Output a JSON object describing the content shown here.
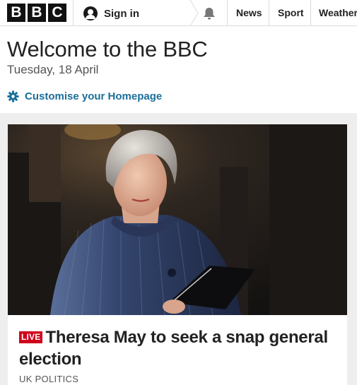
{
  "header": {
    "logo_letters": [
      "B",
      "B",
      "C"
    ],
    "signin_label": "Sign in",
    "nav": [
      {
        "label": "News"
      },
      {
        "label": "Sport"
      },
      {
        "label": "Weather"
      }
    ]
  },
  "welcome": {
    "title": "Welcome to the BBC",
    "date": "Tuesday, 18 April",
    "customise_label": "Customise your Homepage"
  },
  "story": {
    "live_badge": "LIVE",
    "headline": "Theresa May to seek a snap general election",
    "category": "UK POLITICS",
    "image_icon": "news-photo"
  },
  "colors": {
    "link_blue": "#1b6e9b",
    "live_red": "#d0021b",
    "band_grey": "#eeeeee"
  }
}
